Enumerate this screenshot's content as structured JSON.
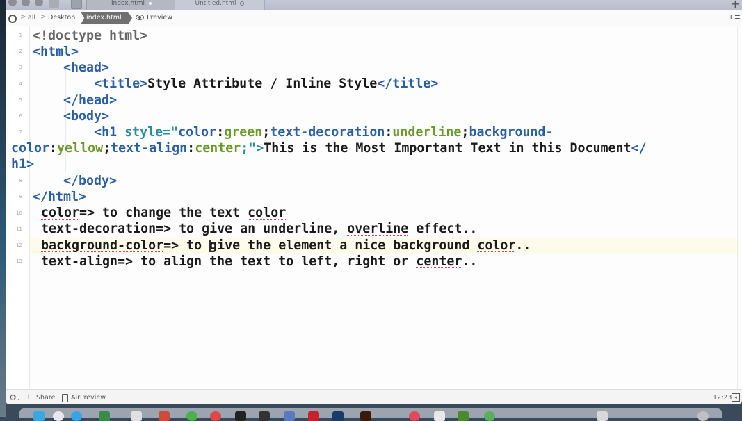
{
  "tabs": [
    {
      "label": "index.html",
      "state": "modified",
      "active": true
    },
    {
      "label": "Untitled.html",
      "state": "unsaved",
      "active": false
    }
  ],
  "breadcrumb": {
    "items": [
      "all",
      "Desktop"
    ],
    "active": "index.html",
    "preview_label": "Preview"
  },
  "editor": {
    "line_numbers": [
      "1",
      "2",
      "3",
      "4",
      "5",
      "6",
      "7",
      "",
      "",
      "8",
      "9",
      "10",
      "11",
      "12",
      "13"
    ],
    "lines": {
      "l1": "<!doctype html>",
      "l2": "<html>",
      "l3": "<head>",
      "l4_open": "<title>",
      "l4_text": "Style Attribute / Inline Style",
      "l4_close": "</title>",
      "l5": "</head>",
      "l6": "<body>",
      "l7_tag": "<h1",
      "l7_attr": "style=\"",
      "l7_p1": "color",
      "l7_v1": "green",
      "l7_p2": "text-decoration",
      "l7_v2": "underline",
      "l7_p3": "background-",
      "l7b_p3": "color",
      "l7b_v3": "yellow",
      "l7b_p4": "text-align",
      "l7b_v4": "center",
      "l7b_end": ";\">",
      "l7b_text": "This is the Most Important Text in this Document",
      "l7b_close": "</",
      "l7c_close": "h1>",
      "l8": "</body>",
      "l9": "</html>",
      "l10_a": "color",
      "l10_b": "=> to change the text ",
      "l10_c": "color",
      "l11_a": "text-decoration=> to give an underline, ",
      "l11_b": "overline",
      "l11_c": " effect..",
      "l12_a": "background-color",
      "l12_b": "=> to ",
      "l12_c": "give the element a nice background ",
      "l12_d": "color",
      "l12_e": "..",
      "l13_a": "text-align=> to align the text to left, right or ",
      "l13_b": "center",
      "l13_c": ".."
    }
  },
  "statusbar": {
    "share_label": "Share",
    "airpreview_label": "AirPreview",
    "cursor_position": "12:23"
  },
  "colors": {
    "tag": "#2b5fa3",
    "attribute": "#2b8aa6",
    "value": "#6a9a2a",
    "current_line": "#fdfbe9"
  }
}
